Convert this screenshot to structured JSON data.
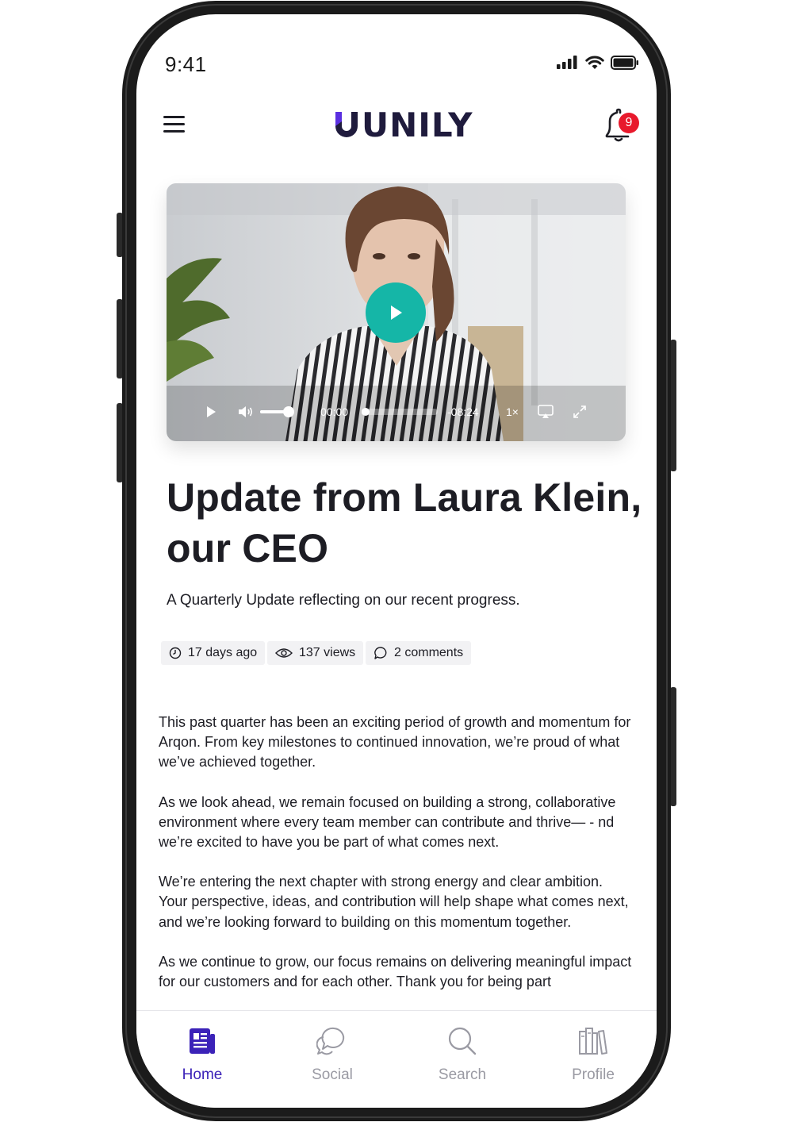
{
  "status_bar": {
    "time": "9:41"
  },
  "header": {
    "logo_text": "UNILY",
    "notification_count": "9"
  },
  "video": {
    "current_time": "00:00",
    "remaining_time": "-08:24",
    "speed": "1×",
    "progress": 0.0,
    "volume": 0.85,
    "accent_color": "#15b6a7"
  },
  "article": {
    "title": "Update from Laura Klein, our CEO",
    "subtitle": "A Quarterly Update reflecting on our recent progress.",
    "meta": {
      "time_ago": "17 days ago",
      "views": "137 views",
      "comments": "2 comments"
    },
    "paragraphs": [
      "This past quarter has been an exciting period of growth and momentum for Arqon. From key milestones to continued innovation, we’re proud of what we’ve achieved together.",
      "As we look ahead, we remain focused on building a strong, collaborative environment where every team member can contribute and thrive— - nd we’re excited to have you be part of what comes next.",
      "We’re entering the next chapter with strong energy and clear ambition. Your perspective, ideas, and contribution will help shape what comes next, and we’re looking forward to building on this momentum together.",
      "As we continue to grow, our focus remains on delivering meaningful impact for our customers and for each other. Thank you for being part"
    ]
  },
  "tabbar": {
    "tabs": [
      {
        "label": "Home",
        "icon": "newspaper-icon",
        "active": true
      },
      {
        "label": "Social",
        "icon": "chat-bubbles-icon",
        "active": false
      },
      {
        "label": "Search",
        "icon": "search-icon",
        "active": false
      },
      {
        "label": "Profile",
        "icon": "books-icon",
        "active": false
      }
    ],
    "active_color": "#3b22b8",
    "inactive_color": "#9a9aa3"
  }
}
